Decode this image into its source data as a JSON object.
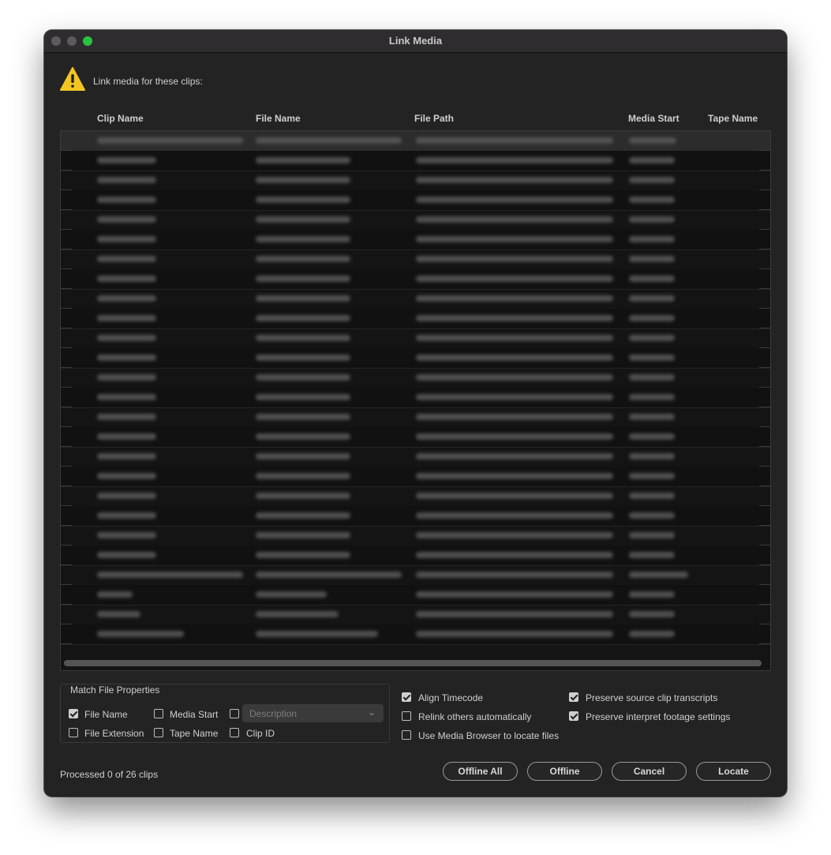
{
  "window": {
    "title": "Link Media"
  },
  "header": {
    "prompt": "Link media for these clips:"
  },
  "table": {
    "columns": [
      "Clip Name",
      "File Name",
      "File Path",
      "Media Start",
      "Tape Name"
    ],
    "row_count_visible": 26
  },
  "match": {
    "legend": "Match File Properties",
    "file_name": {
      "label": "File Name",
      "checked": true
    },
    "media_start": {
      "label": "Media Start",
      "checked": false
    },
    "description": {
      "placeholder": "Description",
      "checked": false
    },
    "file_extension": {
      "label": "File Extension",
      "checked": false
    },
    "tape_name": {
      "label": "Tape Name",
      "checked": false
    },
    "clip_id": {
      "label": "Clip ID",
      "checked": false
    }
  },
  "options": {
    "align_timecode": {
      "label": "Align Timecode",
      "checked": true
    },
    "relink_others": {
      "label": "Relink others automatically",
      "checked": false
    },
    "use_media_browser": {
      "label": "Use Media Browser to locate files",
      "checked": false
    },
    "preserve_transcripts": {
      "label": "Preserve source clip transcripts",
      "checked": true
    },
    "preserve_interpret": {
      "label": "Preserve interpret footage settings",
      "checked": true
    }
  },
  "status": "Processed 0 of 26 clips",
  "buttons": {
    "offline_all": "Offline All",
    "offline": "Offline",
    "cancel": "Cancel",
    "locate": "Locate"
  },
  "colors": {
    "max_button": "#29c23f",
    "warning": "#f2c522",
    "background": "#232323"
  }
}
